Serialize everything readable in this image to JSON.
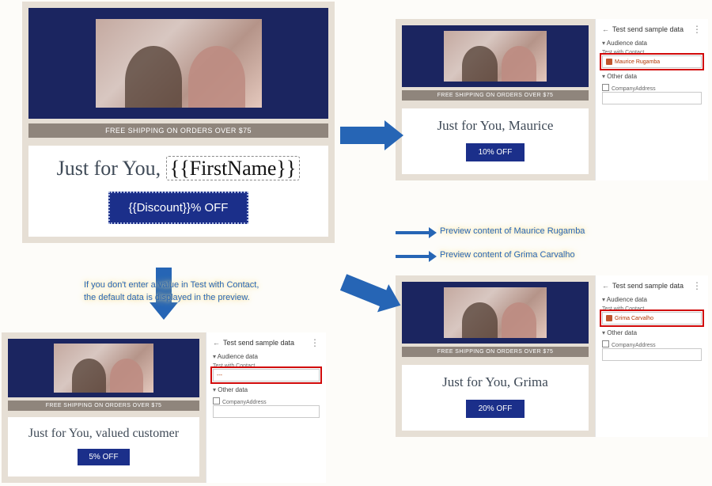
{
  "shipping_banner": "FREE SHIPPING ON ORDERS OVER $75",
  "panel": {
    "title": "Test send sample data",
    "sect_audience": "Audience data",
    "sect_other": "Other data",
    "lbl_contact": "Test with Contact",
    "lbl_company": "CompanyAddress"
  },
  "template": {
    "headline_prefix": "Just for You, ",
    "headline_token": "{{FirstName}}",
    "cta_token": "{{Discount}}% OFF"
  },
  "no_contact": {
    "headline": "Just for You, valued customer",
    "cta": "5% OFF",
    "contact_value": "---"
  },
  "maurice": {
    "headline": "Just for You, Maurice",
    "cta": "10% OFF",
    "contact_value": "Maurice Rugamba"
  },
  "grima": {
    "headline": "Just for You, Grima",
    "cta": "20% OFF",
    "contact_value": "Grima Carvalho"
  },
  "captions": {
    "c0a": "If you don't enter a value in Test with Contact,",
    "c0b": "the default data is displayed in the preview.",
    "c1": "Preview content of Maurice Rugamba",
    "c2": "Preview content of Grima Carvalho"
  }
}
